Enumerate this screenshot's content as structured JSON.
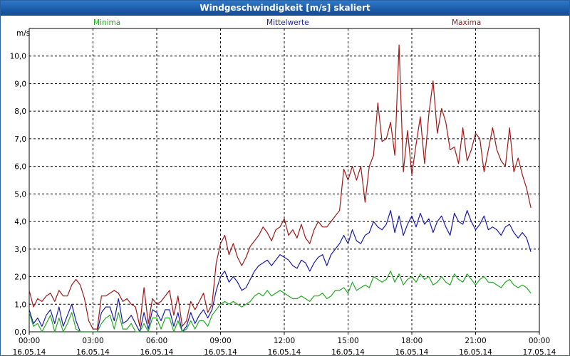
{
  "window": {
    "title": "Windgeschwindigkeit [m/s] skaliert"
  },
  "chart_data": {
    "type": "line",
    "ylabel": "m/s",
    "ylim": [
      0,
      11
    ],
    "grid": true,
    "legend_placement": "top",
    "y_ticks": [
      "0,0",
      "1,0",
      "2,0",
      "3,0",
      "4,0",
      "5,0",
      "6,0",
      "7,0",
      "8,0",
      "9,0",
      "10,0"
    ],
    "x_ticks": [
      {
        "time": "00:00",
        "date": "16.05.14"
      },
      {
        "time": "03:00",
        "date": "16.05.14"
      },
      {
        "time": "06:00",
        "date": "16.05.14"
      },
      {
        "time": "09:00",
        "date": "16.05.14"
      },
      {
        "time": "12:00",
        "date": "16.05.14"
      },
      {
        "time": "15:00",
        "date": "16.05.14"
      },
      {
        "time": "18:00",
        "date": "16.05.14"
      },
      {
        "time": "21:00",
        "date": "16.05.14"
      },
      {
        "time": "00:00",
        "date": "17.05.14"
      }
    ],
    "x_hours": [
      0.0,
      0.2,
      0.4,
      0.6,
      0.8,
      1.0,
      1.2,
      1.4,
      1.6,
      1.8,
      2.0,
      2.2,
      2.4,
      2.6,
      2.8,
      3.0,
      3.2,
      3.4,
      3.6,
      3.8,
      4.0,
      4.2,
      4.4,
      4.6,
      4.8,
      5.0,
      5.2,
      5.4,
      5.6,
      5.8,
      6.0,
      6.2,
      6.4,
      6.6,
      6.8,
      7.0,
      7.2,
      7.4,
      7.6,
      7.8,
      8.0,
      8.2,
      8.4,
      8.6,
      8.8,
      9.0,
      9.2,
      9.4,
      9.6,
      9.8,
      10.0,
      10.2,
      10.4,
      10.6,
      10.8,
      11.0,
      11.2,
      11.4,
      11.6,
      11.8,
      12.0,
      12.2,
      12.4,
      12.6,
      12.8,
      13.0,
      13.2,
      13.4,
      13.6,
      13.8,
      14.0,
      14.2,
      14.4,
      14.6,
      14.8,
      15.0,
      15.2,
      15.4,
      15.6,
      15.8,
      16.0,
      16.2,
      16.4,
      16.6,
      16.8,
      17.0,
      17.2,
      17.4,
      17.6,
      17.8,
      18.0,
      18.2,
      18.4,
      18.6,
      18.8,
      19.0,
      19.2,
      19.4,
      19.6,
      19.8,
      20.0,
      20.2,
      20.4,
      20.6,
      20.8,
      21.0,
      21.2,
      21.4,
      21.6,
      21.8,
      22.0,
      22.2,
      22.4,
      22.6,
      22.8,
      23.0,
      23.2,
      23.4,
      23.6
    ],
    "series": [
      {
        "name": "Maxima",
        "color": "#a01818",
        "values": [
          1.5,
          0.9,
          1.2,
          1.1,
          1.3,
          1.4,
          1.1,
          1.5,
          1.3,
          1.3,
          1.7,
          1.9,
          1.7,
          1.2,
          0.4,
          0.1,
          0.1,
          1.3,
          1.3,
          1.4,
          1.5,
          1.4,
          1.1,
          1.2,
          1.0,
          0.9,
          0.2,
          1.6,
          0.3,
          1.2,
          1.0,
          1.1,
          1.3,
          1.5,
          0.6,
          1.3,
          0.2,
          0.4,
          1.1,
          0.8,
          1.1,
          1.4,
          0.7,
          1.0,
          2.5,
          3.2,
          3.5,
          2.8,
          3.2,
          2.7,
          2.4,
          2.7,
          3.1,
          3.3,
          3.5,
          3.8,
          3.6,
          3.3,
          3.7,
          3.8,
          4.1,
          3.5,
          3.7,
          3.4,
          3.9,
          3.4,
          3.2,
          3.7,
          4.0,
          3.8,
          3.8,
          4.0,
          4.2,
          4.4,
          5.9,
          5.5,
          6.0,
          5.5,
          6.0,
          4.7,
          6.0,
          6.4,
          8.3,
          6.9,
          7.0,
          7.6,
          6.4,
          10.4,
          5.8,
          7.3,
          5.7,
          6.8,
          7.8,
          6.1,
          7.9,
          9.1,
          7.2,
          8.1,
          7.6,
          6.6,
          6.7,
          6.1,
          7.4,
          6.2,
          6.6,
          7.2,
          7.0,
          5.8,
          6.6,
          7.4,
          6.6,
          6.2,
          6.0,
          7.4,
          5.8,
          6.3,
          5.7,
          5.2,
          4.5
        ]
      },
      {
        "name": "Mittelwerte",
        "color": "#1a1aaa",
        "values": [
          0.8,
          0.3,
          0.5,
          0.2,
          0.6,
          0.8,
          0.3,
          0.9,
          0.2,
          0.6,
          1.0,
          0.4,
          0.0,
          0.0,
          0.0,
          0.0,
          0.0,
          0.7,
          0.9,
          0.9,
          0.4,
          1.2,
          0.3,
          0.4,
          0.6,
          0.3,
          0.0,
          0.7,
          0.1,
          0.8,
          0.7,
          0.4,
          0.8,
          0.8,
          0.2,
          0.7,
          0.0,
          0.2,
          0.7,
          0.3,
          0.6,
          0.8,
          0.5,
          0.8,
          1.5,
          2.0,
          2.2,
          1.8,
          2.0,
          1.8,
          1.5,
          1.6,
          1.9,
          2.2,
          2.4,
          2.5,
          2.6,
          2.4,
          2.6,
          2.8,
          2.7,
          2.6,
          2.4,
          2.3,
          2.6,
          2.5,
          2.2,
          2.5,
          2.7,
          2.8,
          2.4,
          2.8,
          3.0,
          3.2,
          3.5,
          3.2,
          3.7,
          3.3,
          3.2,
          3.5,
          3.6,
          4.0,
          3.8,
          3.7,
          3.9,
          4.4,
          3.6,
          4.2,
          3.5,
          3.9,
          4.2,
          3.8,
          4.3,
          3.9,
          4.1,
          3.6,
          4.0,
          4.2,
          3.8,
          3.5,
          4.3,
          4.0,
          3.9,
          4.4,
          4.0,
          3.7,
          3.9,
          4.2,
          3.7,
          3.8,
          3.7,
          3.5,
          3.8,
          3.9,
          3.6,
          3.4,
          3.6,
          3.4,
          2.9
        ]
      },
      {
        "name": "Minima",
        "color": "#22aa22",
        "values": [
          0.7,
          0.2,
          0.3,
          0.0,
          0.3,
          0.6,
          0.0,
          0.5,
          0.0,
          0.3,
          0.7,
          0.1,
          0.0,
          0.0,
          0.0,
          0.0,
          0.0,
          0.3,
          0.5,
          0.6,
          0.1,
          0.7,
          0.1,
          0.1,
          0.3,
          0.0,
          0.0,
          0.3,
          0.0,
          0.5,
          0.5,
          0.1,
          0.5,
          0.5,
          0.0,
          0.4,
          0.0,
          0.1,
          0.4,
          0.1,
          0.4,
          0.4,
          0.2,
          0.6,
          0.8,
          1.0,
          1.1,
          1.0,
          1.1,
          1.0,
          0.9,
          1.0,
          1.1,
          1.3,
          1.4,
          1.3,
          1.5,
          1.3,
          1.4,
          1.5,
          1.4,
          1.3,
          1.2,
          1.2,
          1.3,
          1.2,
          1.1,
          1.3,
          1.3,
          1.4,
          1.2,
          1.3,
          1.5,
          1.5,
          1.6,
          1.4,
          1.8,
          1.5,
          1.6,
          1.7,
          1.6,
          2.0,
          1.9,
          1.8,
          1.9,
          2.2,
          1.8,
          2.1,
          1.7,
          1.9,
          2.0,
          1.8,
          2.1,
          1.9,
          2.0,
          1.7,
          1.8,
          2.0,
          1.8,
          1.7,
          2.1,
          1.9,
          1.8,
          2.1,
          1.9,
          1.7,
          1.9,
          2.0,
          1.8,
          1.8,
          1.7,
          1.6,
          1.8,
          1.9,
          1.7,
          1.6,
          1.7,
          1.6,
          1.4
        ]
      }
    ]
  },
  "legend": {
    "minima": "Minima",
    "mittelwerte": "Mittelwerte",
    "maxima": "Maxima",
    "colors": {
      "minima": "#22aa22",
      "mittelwerte": "#1a1aaa",
      "maxima": "#a01818"
    }
  }
}
